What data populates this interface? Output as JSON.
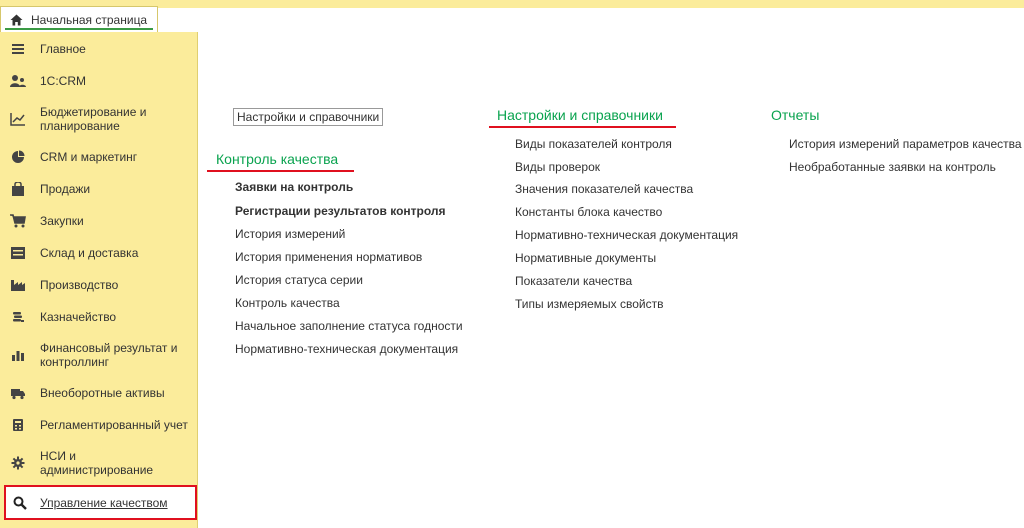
{
  "home_tab": {
    "label": "Начальная страница",
    "icon": "home-icon"
  },
  "sidebar": {
    "items": [
      {
        "label": "Главное",
        "icon": "menu-lines-icon"
      },
      {
        "label": "1С:CRM",
        "icon": "users-icon"
      },
      {
        "label": "Бюджетирование и планирование",
        "icon": "budget-chart-icon"
      },
      {
        "label": "CRM и маркетинг",
        "icon": "pie-icon"
      },
      {
        "label": "Продажи",
        "icon": "bag-icon"
      },
      {
        "label": "Закупки",
        "icon": "cart-icon"
      },
      {
        "label": "Склад и доставка",
        "icon": "warehouse-icon"
      },
      {
        "label": "Производство",
        "icon": "factory-icon"
      },
      {
        "label": "Казначейство",
        "icon": "coins-icon"
      },
      {
        "label": "Финансовый результат и контроллинг",
        "icon": "bar-chart-icon"
      },
      {
        "label": "Внеоборотные активы",
        "icon": "truck-icon"
      },
      {
        "label": "Регламентированный учет",
        "icon": "calculator-icon"
      },
      {
        "label": "НСИ и администрирование",
        "icon": "gear-icon"
      },
      {
        "label": "Управление качеством",
        "icon": "search-icon",
        "active": true
      }
    ]
  },
  "content": {
    "settings_button": "Настройки и справочники",
    "quality_control": {
      "title": "Контроль качества",
      "links": [
        {
          "label": "Заявки на контроль",
          "bold": true
        },
        {
          "label": "Регистрации результатов контроля",
          "bold": true
        },
        {
          "label": "История измерений",
          "bold": false
        },
        {
          "label": "История применения нормативов",
          "bold": false
        },
        {
          "label": "История статуса серии",
          "bold": false
        },
        {
          "label": "Контроль качества",
          "bold": false
        },
        {
          "label": "Начальное заполнение статуса годности",
          "bold": false
        },
        {
          "label": "Нормативно-техническая документация",
          "bold": false
        }
      ]
    },
    "settings": {
      "title": "Настройки и справочники",
      "links": [
        "Виды показателей контроля",
        "Виды проверок",
        "Значения показателей качества",
        "Константы блока качество",
        "Нормативно-техническая документация",
        "Нормативные документы",
        "Показатели качества",
        "Типы измеряемых свойств"
      ]
    },
    "reports": {
      "title": "Отчеты",
      "links": [
        "История измерений параметров качества",
        "Необработанные заявки на контроль"
      ]
    }
  },
  "colors": {
    "sidebar_bg": "#fbec9b",
    "section_title": "#0aa34f",
    "highlight": "#e0101f",
    "tab_underline": "#3a9a44"
  }
}
